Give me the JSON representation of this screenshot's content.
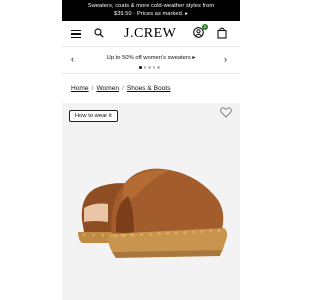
{
  "promo": {
    "line1": "Sweaters, coats & more cold-weather styles from",
    "line2": "$39.50 · Prices as marked. ▸"
  },
  "header": {
    "logo": "J.CREW",
    "cart_badge": "0",
    "icons": [
      "menu-icon",
      "search-icon",
      "account-icon",
      "bag-icon"
    ]
  },
  "carousel": {
    "text": "Up to 50% off women's sweaters ▸",
    "dots": 5,
    "active_dot": 1
  },
  "breadcrumb": {
    "items": [
      "Home",
      "Women",
      "Shoes & Boots"
    ],
    "separator": "/"
  },
  "product": {
    "how_to_label": "How to wear it",
    "colors": {
      "leather": "#a35d2c",
      "sole": "#c9954e",
      "rivet": "#d8b160",
      "background": "#f3f3f3"
    }
  }
}
